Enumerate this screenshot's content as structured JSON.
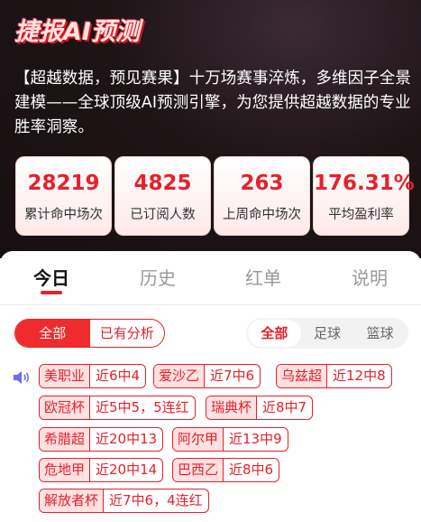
{
  "hero": {
    "title": "捷报AI预测",
    "description": "【超越数据，预见赛果】十万场赛事淬炼，多维因子全景建模——全球顶级AI预测引擎，为您提供超越数据的专业胜率洞察。"
  },
  "stats": [
    {
      "value": "28219",
      "label": "累计命中场次"
    },
    {
      "value": "4825",
      "label": "已订阅人数"
    },
    {
      "value": "263",
      "label": "上周命中场次"
    },
    {
      "value": "176.31%",
      "label": "平均盈利率"
    }
  ],
  "tabs": [
    {
      "label": "今日",
      "active": true
    },
    {
      "label": "历史",
      "active": false
    },
    {
      "label": "红单",
      "active": false
    },
    {
      "label": "说明",
      "active": false
    }
  ],
  "filter_left": [
    {
      "label": "全部",
      "active": true
    },
    {
      "label": "已有分析",
      "active": false
    }
  ],
  "filter_right": [
    {
      "label": "全部",
      "active": true
    },
    {
      "label": "足球",
      "active": false
    },
    {
      "label": "篮球",
      "active": false
    }
  ],
  "speaker_icon": "speaker-icon",
  "leagues": [
    {
      "name": "美职业",
      "record": "近6中4"
    },
    {
      "name": "爱沙乙",
      "record": "近7中6"
    },
    {
      "name": "乌兹超",
      "record": "近12中8"
    },
    {
      "name": "欧冠杯",
      "record": "近5中5，5连红"
    },
    {
      "name": "瑞典杯",
      "record": "近8中7"
    },
    {
      "name": "希腊超",
      "record": "近20中13"
    },
    {
      "name": "阿尔甲",
      "record": "近13中9"
    },
    {
      "name": "危地甲",
      "record": "近20中14"
    },
    {
      "name": "巴西乙",
      "record": "近8中6"
    },
    {
      "name": "解放者杯",
      "record": "近7中6，4连红"
    }
  ],
  "colors": {
    "accent": "#e6212a",
    "hero_bg": "#1d1416",
    "chip_bg": "#ffe1e1"
  }
}
